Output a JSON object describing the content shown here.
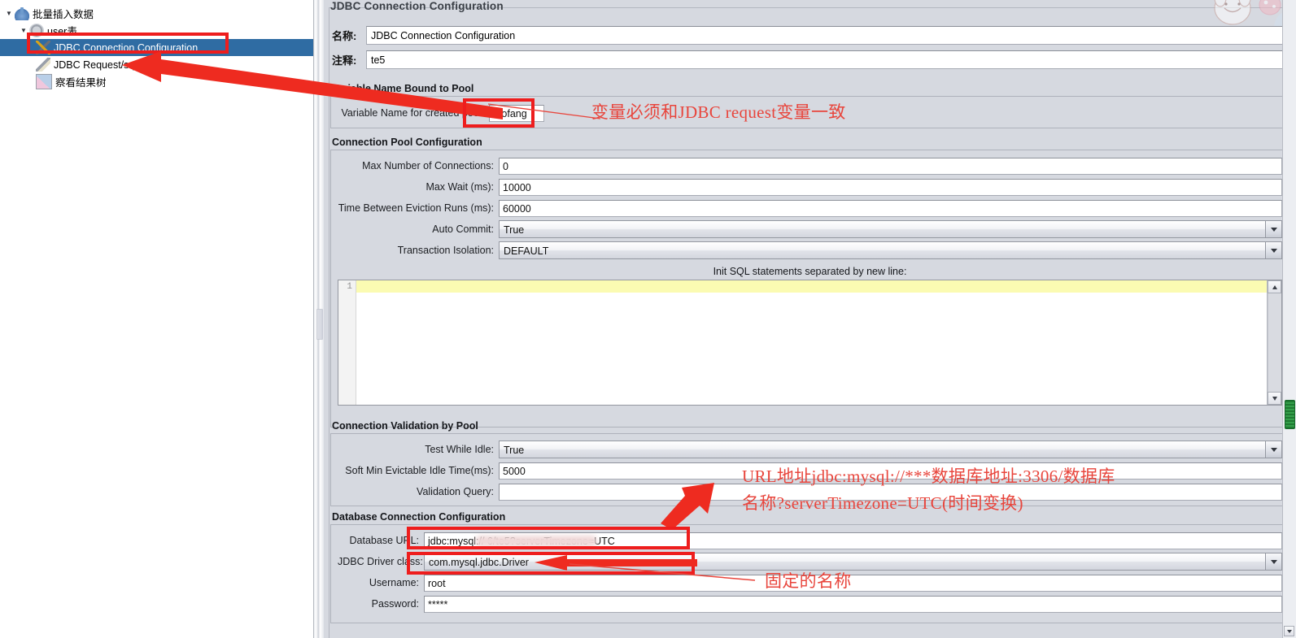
{
  "tree": {
    "items": [
      {
        "label": "批量插入数据",
        "icon": "flask-icon",
        "indent": 1,
        "expanded": true,
        "selected": false
      },
      {
        "label": "user表",
        "icon": "gear-icon",
        "indent": 2,
        "expanded": true,
        "selected": false
      },
      {
        "label": "JDBC Connection Configuration",
        "icon": "tools-icon",
        "indent": 3,
        "expanded": false,
        "selected": true
      },
      {
        "label": "JDBC Request/sql",
        "icon": "pencil-icon",
        "indent": 3,
        "expanded": false,
        "selected": false
      },
      {
        "label": "察看结果树",
        "icon": "chart-icon",
        "indent": 3,
        "expanded": false,
        "selected": false
      }
    ]
  },
  "panel": {
    "title": "JDBC Connection Configuration",
    "name_label": "名称:",
    "name_value": "JDBC Connection Configuration",
    "comment_label": "注释:",
    "comment_value": "te5"
  },
  "variable_group": {
    "title": "Variable Name Bound to Pool",
    "pool_label": "Variable Name for created pool:",
    "pool_value": "mofang"
  },
  "pool_group": {
    "title": "Connection Pool Configuration",
    "rows": [
      {
        "label": "Max Number of Connections:",
        "value": "0",
        "type": "text"
      },
      {
        "label": "Max Wait (ms):",
        "value": "10000",
        "type": "text"
      },
      {
        "label": "Time Between Eviction Runs (ms):",
        "value": "60000",
        "type": "text"
      },
      {
        "label": "Auto Commit:",
        "value": "True",
        "type": "combo"
      },
      {
        "label": "Transaction Isolation:",
        "value": "DEFAULT",
        "type": "combo"
      }
    ],
    "init_sql_caption": "Init SQL statements separated by new line:",
    "init_sql_line_number": "1",
    "init_sql_value": ""
  },
  "validation_group": {
    "title": "Connection Validation by Pool",
    "rows": [
      {
        "label": "Test While Idle:",
        "value": "True",
        "type": "combo"
      },
      {
        "label": "Soft Min Evictable Idle Time(ms):",
        "value": "5000",
        "type": "text"
      },
      {
        "label": "Validation Query:",
        "value": "",
        "type": "text"
      }
    ]
  },
  "database_group": {
    "title": "Database Connection Configuration",
    "rows": [
      {
        "label": "Database URL:",
        "value": "jdbc:mysql://                      6/te5?serverTimezone=UTC",
        "type": "text"
      },
      {
        "label": "JDBC Driver class:",
        "value": "com.mysql.jdbc.Driver",
        "type": "combo"
      },
      {
        "label": "Username:",
        "value": "root",
        "type": "text"
      },
      {
        "label": "Password:",
        "value": "*****",
        "type": "text"
      }
    ]
  },
  "annotations": {
    "variable_note": "变量必须和JDBC request变量一致",
    "url_note_line1": "URL地址jdbc:mysql://***数据库地址:3306/数据库",
    "url_note_line2": "名称?serverTimezone=UTC(时间变换)",
    "driver_note": "固定的名称",
    "highlight_color": "#ee1d1d"
  }
}
